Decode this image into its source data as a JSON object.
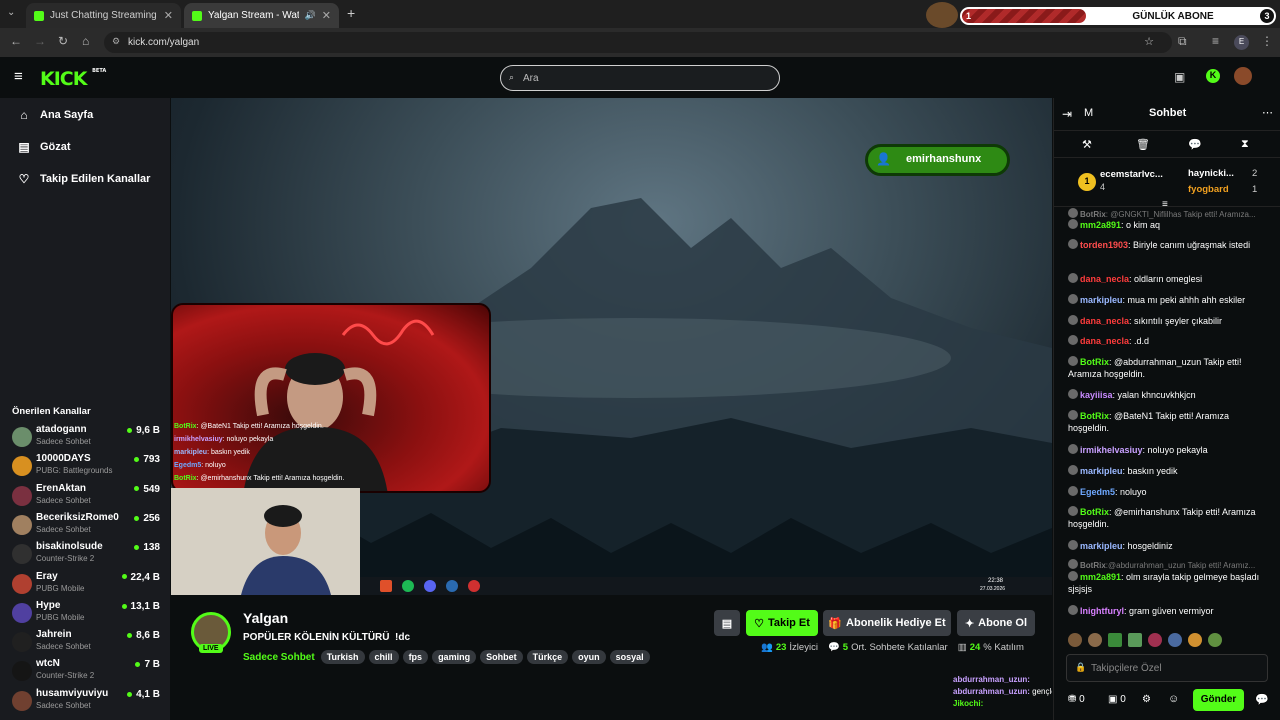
{
  "browser": {
    "tabs": [
      {
        "title": "Just Chatting Streaming - Live S"
      },
      {
        "title": "Yalgan Stream - Watch Live"
      }
    ],
    "new_tab": "+",
    "url": "kick.com/yalgan",
    "ext_widget": {
      "rank": "1",
      "label": "GÜNLÜK ABONE",
      "count": "3"
    },
    "profile_letter": "E"
  },
  "header": {
    "logo": "KICK",
    "logo_badge": "BETA",
    "search_placeholder": "Ara"
  },
  "sidebar": {
    "nav": [
      {
        "label": "Ana Sayfa",
        "icon": "home-icon"
      },
      {
        "label": "Gözat",
        "icon": "browse-icon"
      },
      {
        "label": "Takip Edilen Kanallar",
        "icon": "heart-icon"
      }
    ],
    "recommended_title": "Önerilen Kanallar",
    "channels": [
      {
        "name": "atadogann",
        "category": "Sadece Sohbet",
        "viewers": "9,6 B",
        "color": "#6b8e6b"
      },
      {
        "name": "10000DAYS",
        "category": "PUBG: Battlegrounds",
        "viewers": "793",
        "color": "#d89020"
      },
      {
        "name": "ErenAktan",
        "category": "Sadece Sohbet",
        "viewers": "549",
        "color": "#7a3040"
      },
      {
        "name": "BeceriksizRome0",
        "category": "Sadece Sohbet",
        "viewers": "256",
        "color": "#a08060"
      },
      {
        "name": "bisakinolsude",
        "category": "Counter-Strike 2",
        "viewers": "138",
        "color": "#303030"
      },
      {
        "name": "Eray",
        "category": "PUBG Mobile",
        "viewers": "22,4 B",
        "color": "#b04030"
      },
      {
        "name": "Hype",
        "category": "PUBG Mobile",
        "viewers": "13,1 B",
        "color": "#5040a0"
      },
      {
        "name": "Jahrein",
        "category": "Sadece Sohbet",
        "viewers": "8,6 B",
        "color": "#202020"
      },
      {
        "name": "wtcN",
        "category": "Counter-Strike 2",
        "viewers": "7 B",
        "color": "#151515"
      },
      {
        "name": "husamviyuviyu",
        "category": "Sadece Sohbet",
        "viewers": "4,1 B",
        "color": "#704030"
      }
    ]
  },
  "video": {
    "follow_alert": "emirhanshunx",
    "overlay_chat": [
      {
        "user": "BotRix",
        "text": ": @BateN1 Takip etti! Aramıza hoşgeldin.",
        "color": "#53fc18"
      },
      {
        "user": "irmikhelvasiuy",
        "text": ": noluyo pekayla",
        "color": "#c8a0ff"
      },
      {
        "user": "markipleu",
        "text": ": baskın yedik",
        "color": "#9ab8ff"
      },
      {
        "user": "Egedm5",
        "text": ": noluyo",
        "color": "#6ea8ff"
      },
      {
        "user": "BotRix",
        "text": ": @emirhanshunx Takip etti! Aramıza hoşgeldin.",
        "color": "#53fc18"
      }
    ],
    "clock_time": "22:38",
    "clock_date": "27.03.2026"
  },
  "stream": {
    "streamer": "Yalgan",
    "live_label": "LIVE",
    "title": "POPÜLER KÖLENİN KÜLTÜRÜ  !dc",
    "category": "Sadece Sohbet",
    "tags": [
      "Turkish",
      "chill",
      "fps",
      "gaming",
      "Sohbet",
      "Türkçe",
      "oyun",
      "sosyal"
    ],
    "follow_label": "Takip Et",
    "gift_label": "Abonelik Hediye Et",
    "subscribe_label": "Abone Ol",
    "viewers": "23",
    "viewers_label": "İzleyici",
    "avg_chatters": "5",
    "avg_chatters_label": "Ort. Sohbete Katılanlar",
    "participation": "24",
    "participation_label": "% Katılım",
    "side_chat": [
      {
        "user": "abdurrahman_uzun:",
        "text": ""
      },
      {
        "user": "abdurrahman_uzun:",
        "text": "gençler"
      },
      {
        "user": "Jikochi:",
        "text": ""
      }
    ]
  },
  "chat": {
    "header_letter": "M",
    "title": "Sohbet",
    "leaderboard": [
      {
        "rank": "1",
        "user": "ecemstarlvc...",
        "count": "4"
      },
      {
        "user": "haynicki...",
        "count": "2"
      },
      {
        "user": "fyogbard",
        "count": "1"
      }
    ],
    "messages": [
      {
        "user": "BotRix",
        "text": ": @GNGKTI_Niflilhas Takip etti! Aramıza...",
        "color": "#7a7a7a",
        "faded": true
      },
      {
        "user": "mm2a891",
        "text": ": o kim aq",
        "color": "#53fc18"
      },
      {
        "user": "torden1903",
        "text": ": Biriyle canım uğraşmak istedi",
        "color": "#ff4d4d"
      },
      {
        "user": "dana_necla",
        "text": ": oldların omeglesi",
        "color": "#ff3c3c"
      },
      {
        "user": "markipleu",
        "text": ": mua mı peki ahhh ahh eskiler",
        "color": "#9ab8ff"
      },
      {
        "user": "dana_necla",
        "text": ": sıkıntılı şeyler çıkabilir",
        "color": "#ff3c3c"
      },
      {
        "user": "dana_necla",
        "text": ": .d.d",
        "color": "#ff3c3c"
      },
      {
        "user": "BotRix",
        "text": ": @abdurrahman_uzun Takip etti! Aramıza hoşgeldin.",
        "color": "#53fc18"
      },
      {
        "user": "kayiiisa",
        "text": ": yalan khncuvkhkjcn",
        "color": "#c88aff"
      },
      {
        "user": "BotRix",
        "text": ": @BateN1 Takip etti! Aramıza hoşgeldin.",
        "color": "#53fc18"
      },
      {
        "user": "irmikhelvasiuy",
        "text": ": noluyo pekayla",
        "color": "#c8a0ff"
      },
      {
        "user": "markipleu",
        "text": ": baskın yedik",
        "color": "#9ab8ff"
      },
      {
        "user": "Egedm5",
        "text": ": noluyo",
        "color": "#6ea8ff"
      },
      {
        "user": "BotRix",
        "text": ": @emirhanshunx Takip etti! Aramıza hoşgeldin.",
        "color": "#53fc18"
      },
      {
        "user": "markipleu",
        "text": ": hosgeldiniz",
        "color": "#9ab8ff"
      },
      {
        "user": "BotRix",
        "text": ":@abdurrahman_uzun Takip etti! Aramız...",
        "color": "#7a7a7a",
        "faded": true
      },
      {
        "user": "mm2a891",
        "text": ": olm sırayla takip gelmeye başladı sjsjsjs",
        "color": "#53fc18"
      },
      {
        "user": "lnightfuryl",
        "text": ": gram güven vermiyor",
        "color": "#d880ff"
      }
    ],
    "input_placeholder": "Takipçilere Özel",
    "points_a": "0",
    "points_b": "0",
    "send_label": "Gönder"
  },
  "colors": {
    "brand": "#53fc18",
    "bg": "#0b0e0f",
    "sidebar": "#191b1f"
  }
}
